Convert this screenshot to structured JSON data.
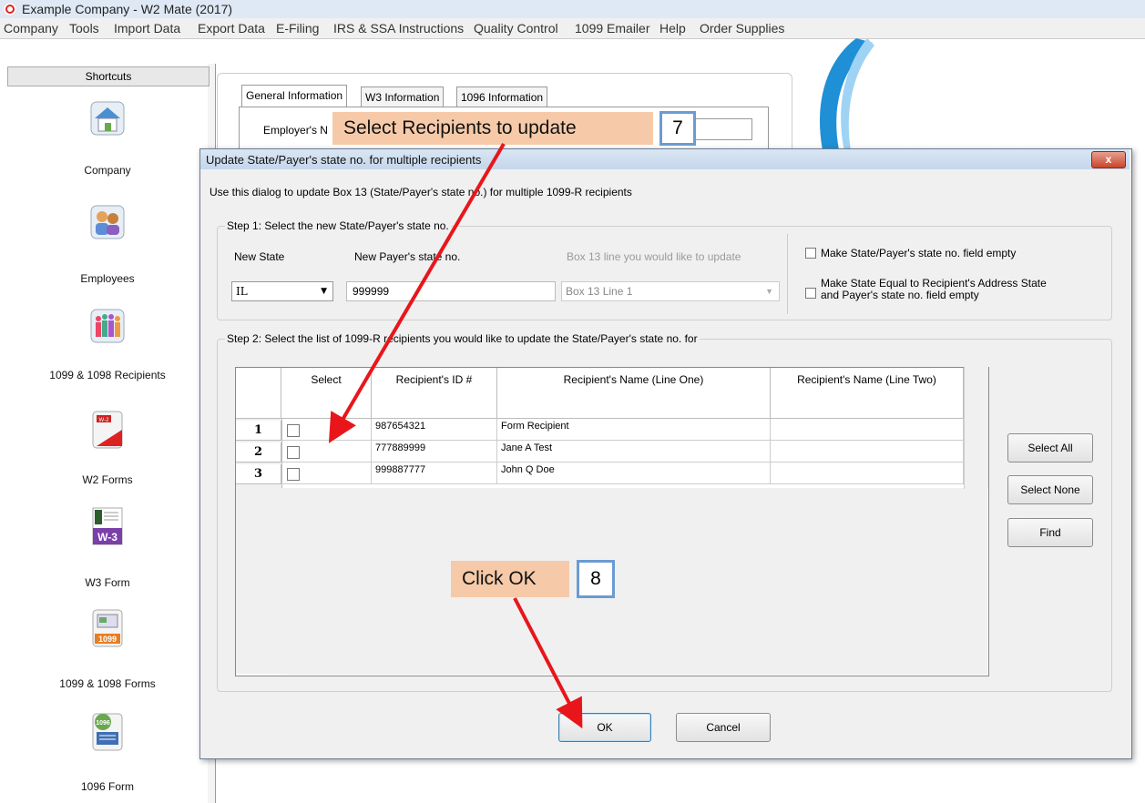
{
  "window": {
    "title": "Example Company - W2 Mate (2017)"
  },
  "menu": [
    "Company",
    "Tools",
    "Import Data",
    "Export Data",
    "E-Filing",
    "IRS & SSA Instructions",
    "Quality Control",
    "1099 Emailer",
    "Help",
    "Order Supplies"
  ],
  "sidebar": {
    "header": "Shortcuts",
    "items": [
      {
        "label": "Company",
        "icon": "house-icon"
      },
      {
        "label": "Employees",
        "icon": "people-icon"
      },
      {
        "label": "1099 & 1098 Recipients",
        "icon": "group-icon"
      },
      {
        "label": "W2 Forms",
        "icon": "w2-form-icon",
        "badge": "W-2"
      },
      {
        "label": "W3 Form",
        "icon": "w3-form-icon",
        "badge": "W-3"
      },
      {
        "label": "1099 & 1098 Forms",
        "icon": "1099-form-icon",
        "badge": "1099"
      },
      {
        "label": "1096 Form",
        "icon": "1096-form-icon",
        "badge": "1096"
      }
    ]
  },
  "background": {
    "tabs": [
      "General Information",
      "W3 Information",
      "1096 Information"
    ],
    "employer_label": "Employer's N"
  },
  "dialog": {
    "title": "Update State/Payer's state no. for multiple recipients",
    "close": "x",
    "description": "Use this dialog to update Box 13 (State/Payer's state no.) for multiple 1099-R recipients",
    "step1": {
      "legend": "Step 1: Select the new State/Payer's state no.",
      "new_state_label": "New State",
      "new_state_value": "IL",
      "payer_no_label": "New Payer's state no.",
      "payer_no_value": "999999",
      "box13_label": "Box 13 line you would like to update",
      "box13_value": "Box 13 Line 1",
      "make_empty_label": "Make State/Payer's state no. field empty",
      "make_equal_label_1": "Make State Equal to Recipient's Address State",
      "make_equal_label_2": "and Payer's state no. field empty"
    },
    "step2": {
      "legend": "Step 2: Select the list of 1099-R recipients you would like to update the State/Payer's state no. for",
      "columns": [
        "Select",
        "Recipient's ID #",
        "Recipient's Name (Line One)",
        "Recipient's Name (Line Two)"
      ],
      "rows": [
        {
          "num": "1",
          "id": "987654321",
          "name1": "Form Recipient",
          "name2": ""
        },
        {
          "num": "2",
          "id": "777889999",
          "name1": "Jane A Test",
          "name2": ""
        },
        {
          "num": "3",
          "id": "999887777",
          "name1": "John Q Doe",
          "name2": ""
        }
      ]
    },
    "buttons": {
      "select_all": "Select All",
      "select_none": "Select None",
      "find": "Find",
      "ok": "OK",
      "cancel": "Cancel"
    }
  },
  "annotations": {
    "callout1": {
      "text": "Select Recipients to update",
      "step": "7"
    },
    "callout2": {
      "text": "Click OK",
      "step": "8"
    },
    "arrow_color": "#e8161b"
  },
  "colors": {
    "callout_bg": "#f6caa8",
    "step_border": "#6b9bd2"
  }
}
